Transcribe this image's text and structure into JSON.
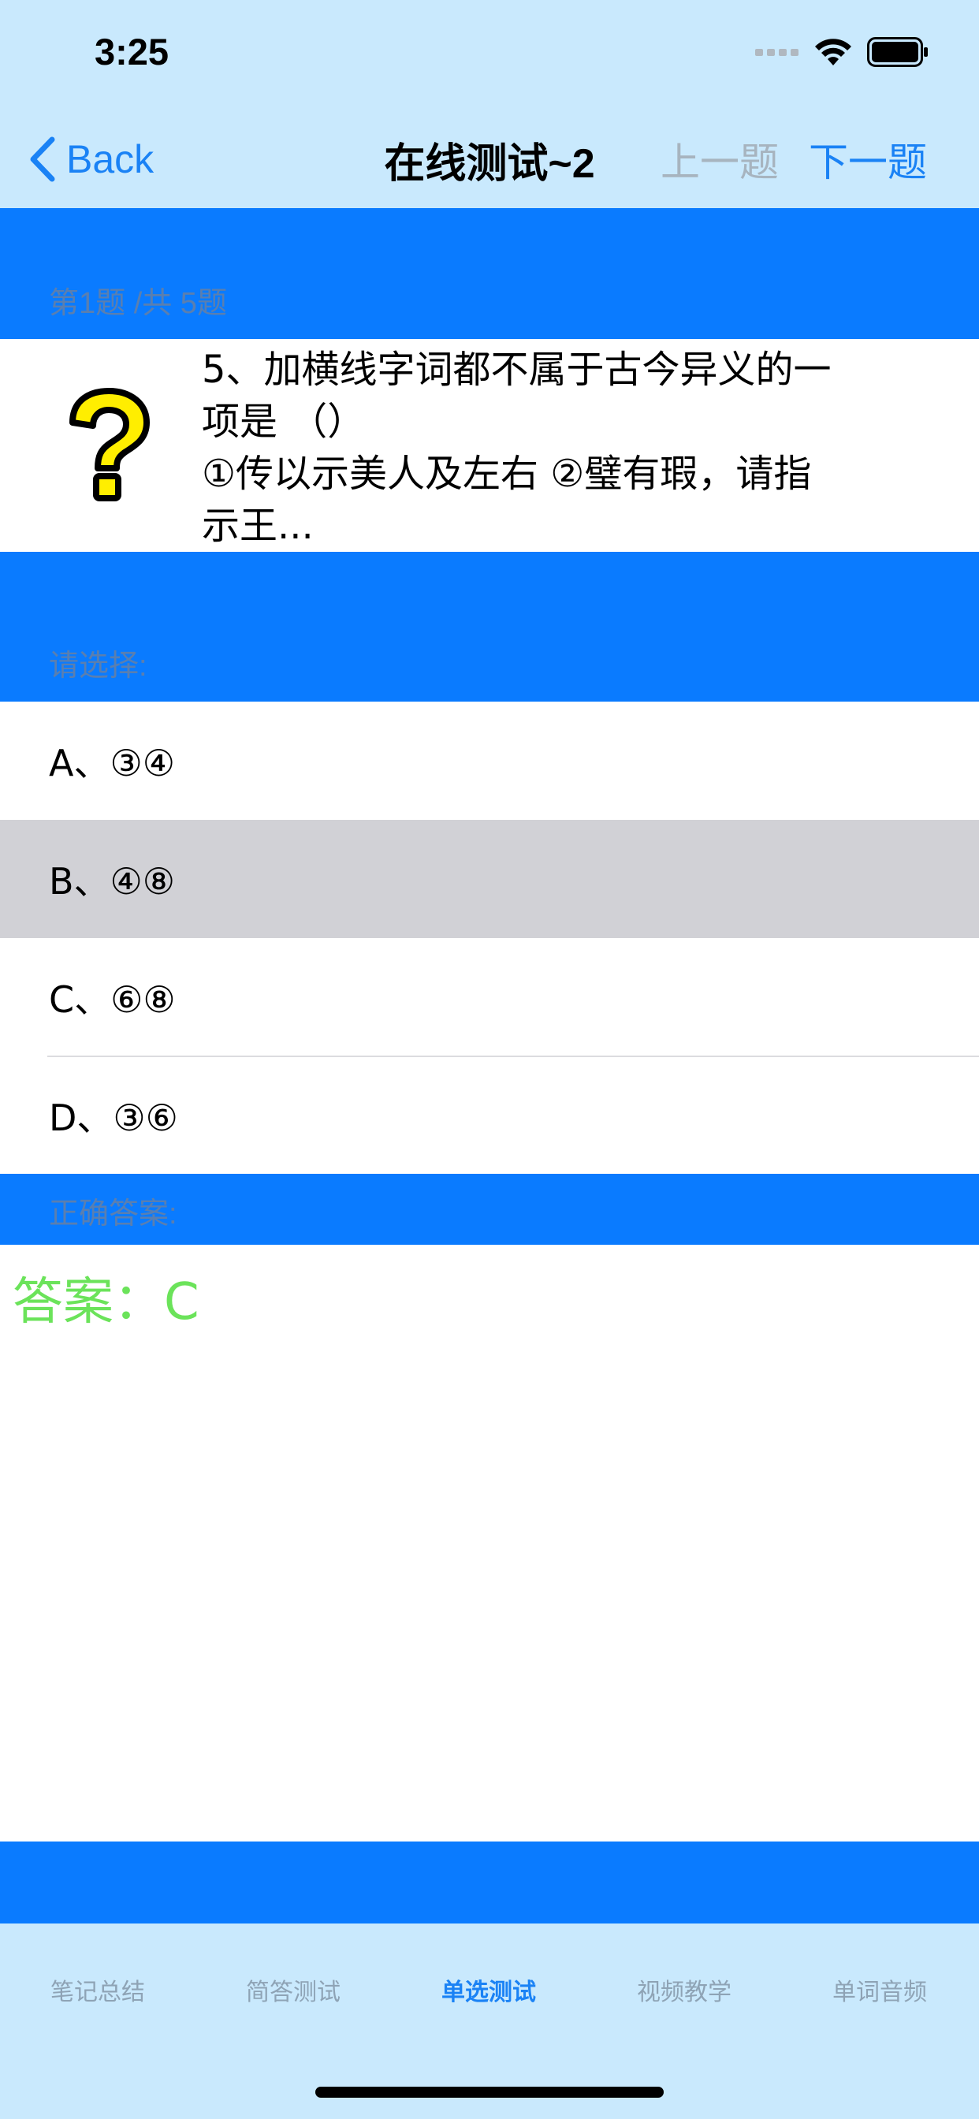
{
  "status": {
    "time": "3:25"
  },
  "nav": {
    "back_label": "Back",
    "title": "在线测试~2",
    "prev_label": "上一题",
    "next_label": "下一题"
  },
  "question_header": {
    "caption": "第1题 /共 5题"
  },
  "question": {
    "text_line1": "5、加横线字词都不属于古今异义的一",
    "text_line2": "项是 （）",
    "text_line3": "①传以示美人及左右 ②璧有瑕，请指",
    "text_line4": "示王..."
  },
  "options_header": {
    "caption": "请选择:"
  },
  "options": [
    {
      "label": "A、③④"
    },
    {
      "label": "B、④⑧"
    },
    {
      "label": "C、⑥⑧"
    },
    {
      "label": "D、③⑥"
    }
  ],
  "selected_option": "B",
  "answer_header": {
    "caption": "正确答案:"
  },
  "answer": {
    "text": "答案：C"
  },
  "tabs": [
    {
      "label": "笔记总结"
    },
    {
      "label": "简答测试"
    },
    {
      "label": "单选测试"
    },
    {
      "label": "视频教学"
    },
    {
      "label": "单词音频"
    }
  ],
  "active_tab": "单选测试",
  "colors": {
    "bar_background": "#c9e9fd",
    "section_blue": "#0a7bff",
    "accent": "#1a82f5",
    "disabled": "#a7b4bf",
    "answer_green": "#6be35a",
    "selected_row": "#d1d1d6"
  }
}
